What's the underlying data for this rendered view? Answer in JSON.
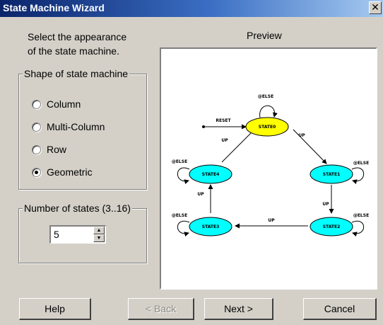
{
  "window": {
    "title": "State Machine Wizard",
    "close_glyph": "✕"
  },
  "intro": {
    "line1": "Select the appearance",
    "line2": "of the state machine."
  },
  "preview": {
    "label": "Preview",
    "reset_label": "RESET",
    "else_label": "@ELSE",
    "up_label": "UP",
    "states": [
      "STATE0",
      "STATE1",
      "STATE2",
      "STATE3",
      "STATE4"
    ],
    "colors": {
      "initial_state": "#ffff00",
      "state": "#00ffff"
    }
  },
  "shape_group": {
    "legend": "Shape of state machine",
    "options": [
      {
        "label": "Column",
        "selected": false
      },
      {
        "label": "Multi-Column",
        "selected": false
      },
      {
        "label": "Row",
        "selected": false
      },
      {
        "label": "Geometric",
        "selected": true
      }
    ]
  },
  "states_group": {
    "legend": "Number of states (3..16)",
    "value": "5"
  },
  "buttons": {
    "help": "Help",
    "back": "< Back",
    "next": "Next >",
    "cancel": "Cancel"
  }
}
